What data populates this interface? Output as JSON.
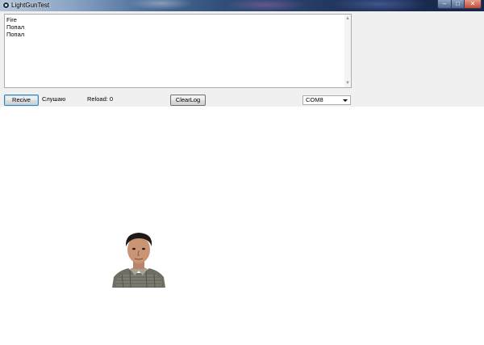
{
  "window": {
    "title": "LightGunTest",
    "controls": [
      "minimize",
      "maximize",
      "close"
    ]
  },
  "log": {
    "lines": [
      "Fire",
      "Попал",
      "Попал"
    ]
  },
  "toolbar": {
    "recive_label": "Recive",
    "status_text": "Слушаю",
    "reload_text": "Reload: 0",
    "clearlog_label": "ClearLog",
    "port_selected": "COM8"
  },
  "icons": {
    "app": "app-icon",
    "minimize": "minimize-icon",
    "maximize": "maximize-icon",
    "close": "close-icon",
    "scroll_up": "scroll-up-arrow-icon",
    "scroll_down": "scroll-down-arrow-icon",
    "dropdown": "chevron-down-icon"
  },
  "colors": {
    "client_background": "#f0f0f0",
    "canvas_background": "#ffffff",
    "default_button_border": "#3c7fb1"
  }
}
